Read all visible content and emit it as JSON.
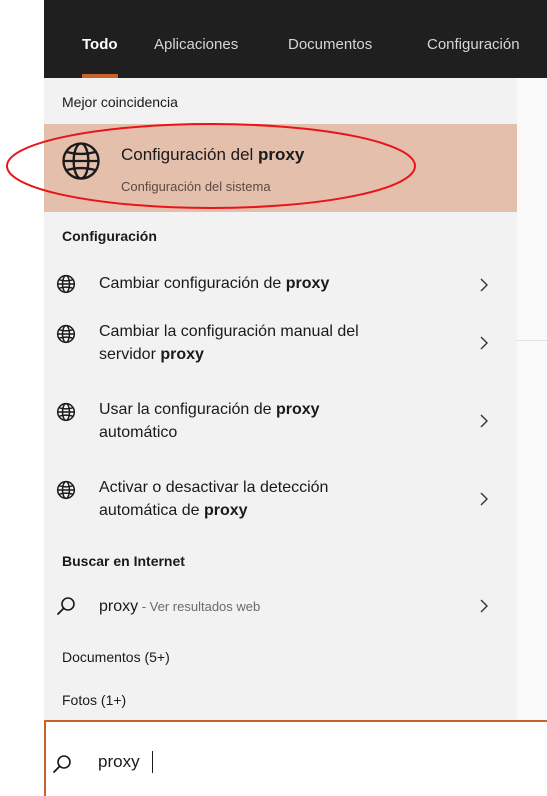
{
  "tabs": [
    {
      "label": "Todo",
      "active": true
    },
    {
      "label": "Aplicaciones",
      "active": false
    },
    {
      "label": "Documentos",
      "active": false
    },
    {
      "label": "Configuración",
      "active": false
    }
  ],
  "sections": {
    "best_match": "Mejor coincidencia",
    "settings": "Configuración",
    "internet": "Buscar en Internet",
    "documents": "Documentos (5+)",
    "photos": "Fotos (1+)"
  },
  "best_match": {
    "title_prefix": "Configuración del ",
    "title_bold": "proxy",
    "subtitle": "Configuración del sistema",
    "icon": "globe-icon"
  },
  "settings_items": [
    {
      "line1": "Cambiar configuración de ",
      "bold": "proxy",
      "line2": "",
      "icon": "globe-icon"
    },
    {
      "line1": "Cambiar la configuración manual del",
      "line2_prefix": "servidor ",
      "bold": "proxy",
      "icon": "globe-icon"
    },
    {
      "line1": "Usar la configuración de ",
      "bold": "proxy",
      "line2": "automático",
      "icon": "globe-icon"
    },
    {
      "line1": "Activar o desactivar la detección",
      "line2_prefix": "automática de ",
      "bold": "proxy",
      "icon": "globe-icon"
    }
  ],
  "web_result": {
    "query": "proxy",
    "suffix": " - Ver resultados web",
    "icon": "search-icon"
  },
  "search": {
    "value": "proxy",
    "icon": "search-icon"
  },
  "colors": {
    "accent": "#c8622a",
    "selected_bg": "#e4bfac",
    "tabbar_bg": "#1f1f1f",
    "panel_bg": "#f2f2f2",
    "annotation_ring": "#e8141b"
  }
}
